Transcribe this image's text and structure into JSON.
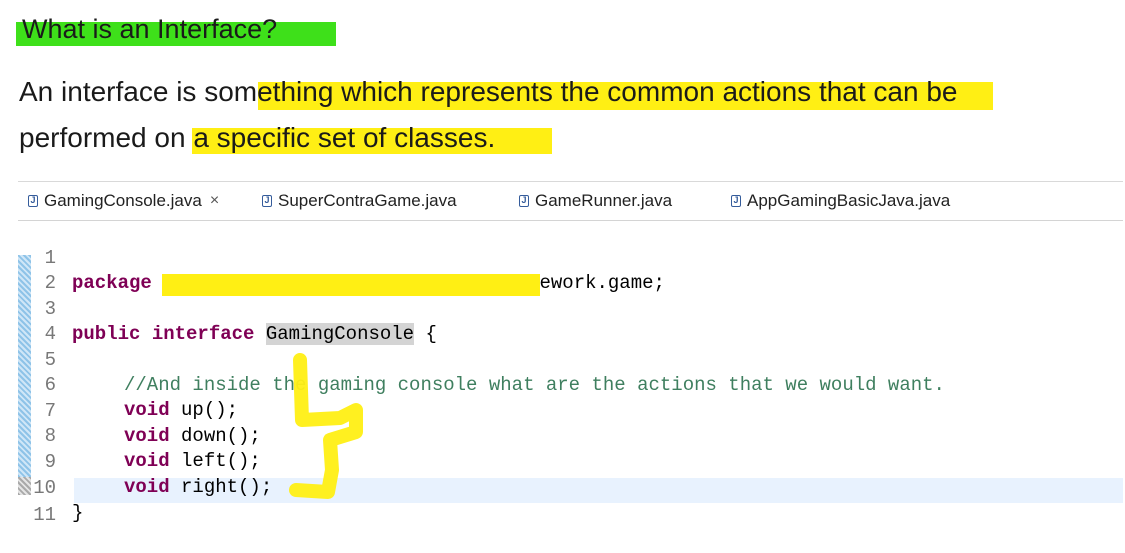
{
  "slide": {
    "heading": "What is an Interface?",
    "paragraph_line1": "An interface is something which represents the common actions that can be",
    "paragraph_line2": "performed on a specific set of classes."
  },
  "editor": {
    "tabs": [
      {
        "label": "GamingConsole.java",
        "active": true,
        "closable": true,
        "close_glyph": "×"
      },
      {
        "label": "SuperContraGame.java"
      },
      {
        "label": "GameRunner.java"
      },
      {
        "label": "AppGamingBasicJava.java"
      }
    ],
    "line_numbers": [
      "1",
      "2",
      "3",
      "4",
      "5",
      "6",
      "7",
      "8",
      "9",
      "10",
      "11"
    ],
    "code": {
      "l1_kw": "package",
      "l1_rest": " com.in28minutes.learn_spring_framework.game;",
      "l3_kw1": "public",
      "l3_kw2": "interface",
      "l3_name": "GamingConsole",
      "l3_brace": " {",
      "l5_comment": "//And inside the gaming console what are the actions that we would want.",
      "l6_kw": "void",
      "l6_rest": " up();",
      "l7_kw": "void",
      "l7_rest": " down();",
      "l8_kw": "void",
      "l8_rest": " left();",
      "l9_kw": "void",
      "l9_rest": " right();",
      "l10": "}"
    }
  },
  "colors": {
    "green_highlight": "#3ee01a",
    "yellow_highlight": "#ffef14",
    "keyword": "#7f0055",
    "comment": "#3f7f5f"
  }
}
